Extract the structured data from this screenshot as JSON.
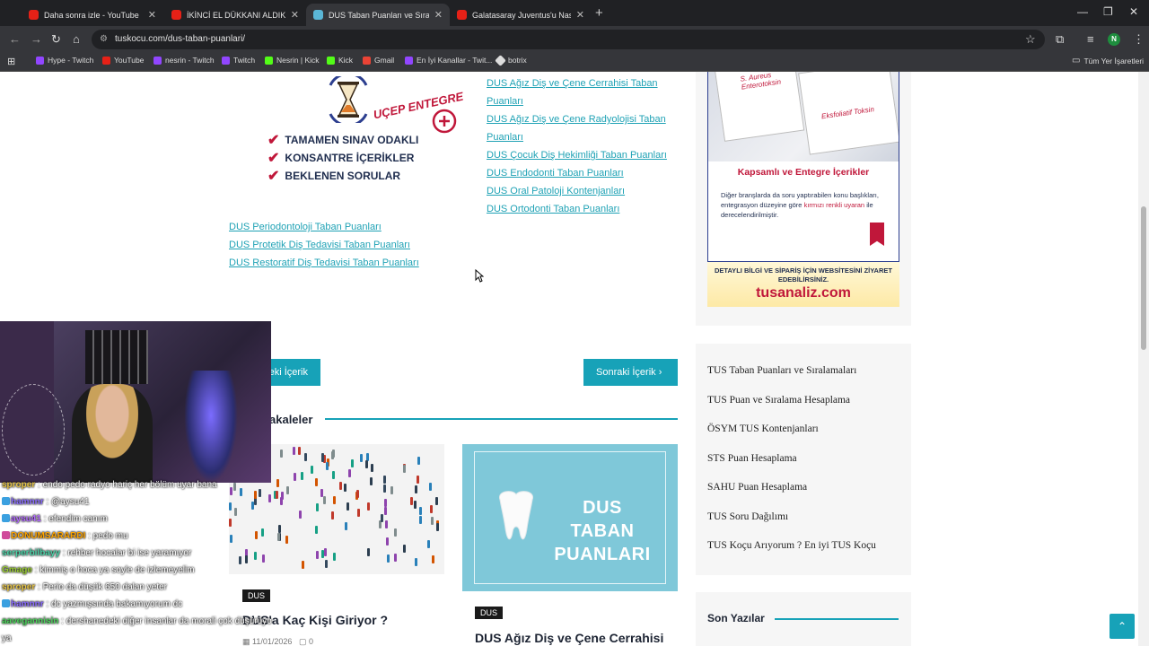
{
  "browser": {
    "tabs": [
      {
        "title": "Daha sonra izle - YouTube",
        "icon": "youtube-icon",
        "active": false
      },
      {
        "title": "İKİNCİ EL DÜKKANI ALDIK SON",
        "icon": "youtube-icon",
        "active": false
      },
      {
        "title": "DUS Taban Puanları ve Sıralama",
        "icon": "site-favicon",
        "active": true
      },
      {
        "title": "Galatasaray Juventus'u Nasıl Ye",
        "icon": "youtube-icon",
        "active": false
      }
    ],
    "url": "tuskocu.com/dus-taban-puanlari/",
    "profile_initial": "N",
    "bookmarks": [
      {
        "label": "Hype - Twitch",
        "icon": "twitch-icon"
      },
      {
        "label": "YouTube",
        "icon": "youtube-icon"
      },
      {
        "label": "nesrin - Twitch",
        "icon": "twitch-icon"
      },
      {
        "label": "Twitch",
        "icon": "twitch-icon"
      },
      {
        "label": "Nesrin | Kick",
        "icon": "kick-icon"
      },
      {
        "label": "Kick",
        "icon": "kick-icon"
      },
      {
        "label": "Gmail",
        "icon": "gmail-icon"
      },
      {
        "label": "En İyi Kanallar - Twit...",
        "icon": "twitch-icon"
      },
      {
        "label": "botrix",
        "icon": "botrix-icon"
      }
    ],
    "all_bookmarks": "Tüm Yer İşaretleri"
  },
  "promo": {
    "brand": "UÇEP ENTEGRE",
    "checks": [
      "TAMAMEN SINAV ODAKLI",
      "KONSANTRE İÇERİKLER",
      "BEKLENEN SORULAR"
    ]
  },
  "links_right": [
    "DUS Ağız Diş ve Çene Cerrahisi Taban",
    "Puanları",
    "DUS Ağız Diş ve Çene Radyolojisi Taban",
    "Puanları",
    "DUS Çocuk Diş Hekimliği Taban Puanları",
    "DUS Endodonti Taban Puanları",
    "DUS Oral Patoloji Kontenjanları",
    "DUS Ortodonti Taban Puanları"
  ],
  "links_left": [
    "DUS Periodontoloji Taban Puanları",
    "DUS Protetik Diş Tedavisi Taban Puanları",
    "DUS Restoratif Diş Tedavisi Taban Puanları"
  ],
  "ad": {
    "sheet1": "S. Aureus Enterotoksin",
    "sheet2": "Eksfoliatif Toksin",
    "heading": "Kapsamlı ve Entegre İçerikler",
    "body_pre": "Diğer branşlarda da soru yaptırabilen konu başlıkları, entegrasyon düzeyine göre ",
    "body_red": "kırmızı renkli uyaran",
    "body_post": " ile derecelendirilmiştir.",
    "cta": "DETAYLI BİLGİ VE SİPARİŞ İÇİN WEBSİTESİNİ ZİYARET EDEBİLİRSİNİZ.",
    "domain": "tusanaliz.com"
  },
  "nav": {
    "prev": "eki İçerik",
    "next": "Sonraki İçerik"
  },
  "related": {
    "heading": "akaleler",
    "posts": [
      {
        "tag": "DUS",
        "title": "DUS'a Kaç Kişi Giriyor ?",
        "date": "11/01/2026",
        "comments": "0"
      },
      {
        "tag": "DUS",
        "title": "DUS Ağız Diş ve Çene Cerrahisi",
        "image_text": "DUS TABAN PUANLARI"
      }
    ]
  },
  "sidebar_links": [
    "TUS Taban Puanları ve Sıralamaları",
    "TUS Puan ve Sıralama Hesaplama",
    "ÖSYM TUS Kontenjanları",
    "STS Puan Hesaplama",
    "SAHU Puan Hesaplama",
    "TUS Soru Dağılımı",
    "TUS Koçu Arıyorum ? En iyi TUS Koçu"
  ],
  "son_yazilar": "Son Yazılar",
  "chat": [
    {
      "user": "sproper",
      "msg": ": endo pedo radyo hariç her bölüm uyar bana",
      "color": "#e8c547",
      "badge": ""
    },
    {
      "user": "hamnnr",
      "msg": ": @aysu41",
      "color": "#8a6cff",
      "badge": "#3aa0e0"
    },
    {
      "user": "aysu41",
      "msg": ": efendim canım",
      "color": "#b36bff",
      "badge": "#3aa0e0"
    },
    {
      "user": "DONUMSARARDI",
      "msg": ": pedo mu",
      "color": "#ffa500",
      "badge": "#d04a9b"
    },
    {
      "user": "serperbilbayy",
      "msg": ": rehber hocalar bi ise yaramıyor",
      "color": "#4bd3a8",
      "badge": ""
    },
    {
      "user": "Gmage",
      "msg": ": kimmiş o hoca ya soyle de izlemeyelim",
      "color": "#9acd32",
      "badge": ""
    },
    {
      "user": "sproper",
      "msg": ": Perio da düşük 650 dalan yeter",
      "color": "#e8c547",
      "badge": ""
    },
    {
      "user": "hamnnr",
      "msg": ": dc yazmışsında bakamıyorum dc",
      "color": "#8a6cff",
      "badge": "#3aa0e0"
    },
    {
      "user": "aavegannisin",
      "msg": ": dershanedeki diğer insanlar da morali çok düşürüyo",
      "color": "#4bd35a",
      "badge": ""
    },
    {
      "user": "",
      "msg": "ya",
      "color": "#ffffff",
      "badge": ""
    }
  ],
  "colors": {
    "accent": "#17a2b8",
    "brand_red": "#c0173a",
    "link": "#1fa2b5"
  }
}
